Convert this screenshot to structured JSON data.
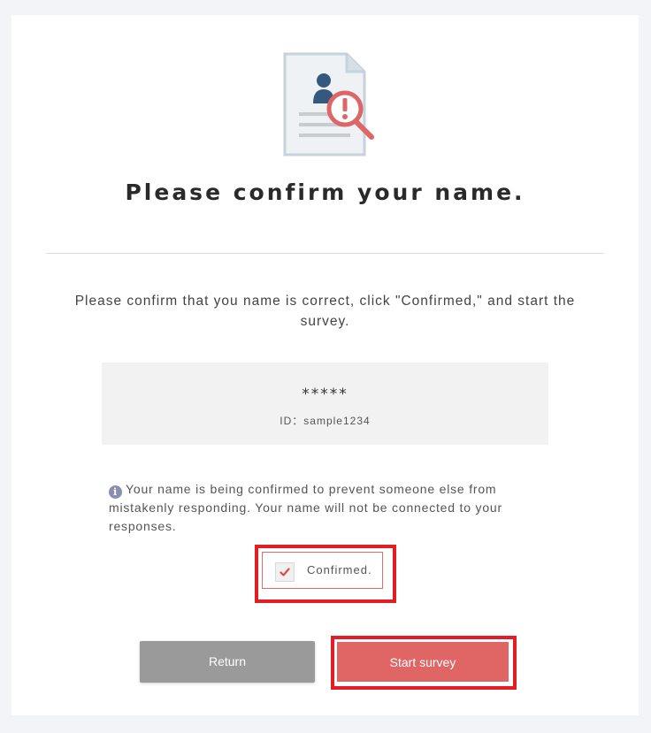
{
  "header": {
    "icon": "document-search-alert-icon",
    "title": "Please confirm your name."
  },
  "instruction": "Please confirm that you name is correct, click \"Confirmed,\" and start the survey.",
  "identity": {
    "masked_name": "*****",
    "id_text": "ID：sample1234"
  },
  "notice": {
    "icon": "info-icon",
    "icon_glyph": "i",
    "text": "Your name is being confirmed to prevent someone else from mistakenly responding. Your name will not be connected to your responses."
  },
  "confirm": {
    "label": "Confirmed.",
    "checked": true
  },
  "actions": {
    "return_label": "Return",
    "start_label": "Start survey"
  },
  "colors": {
    "accent": "#e06666",
    "highlight": "#e41c24",
    "return_button": "#9a9a9a"
  }
}
